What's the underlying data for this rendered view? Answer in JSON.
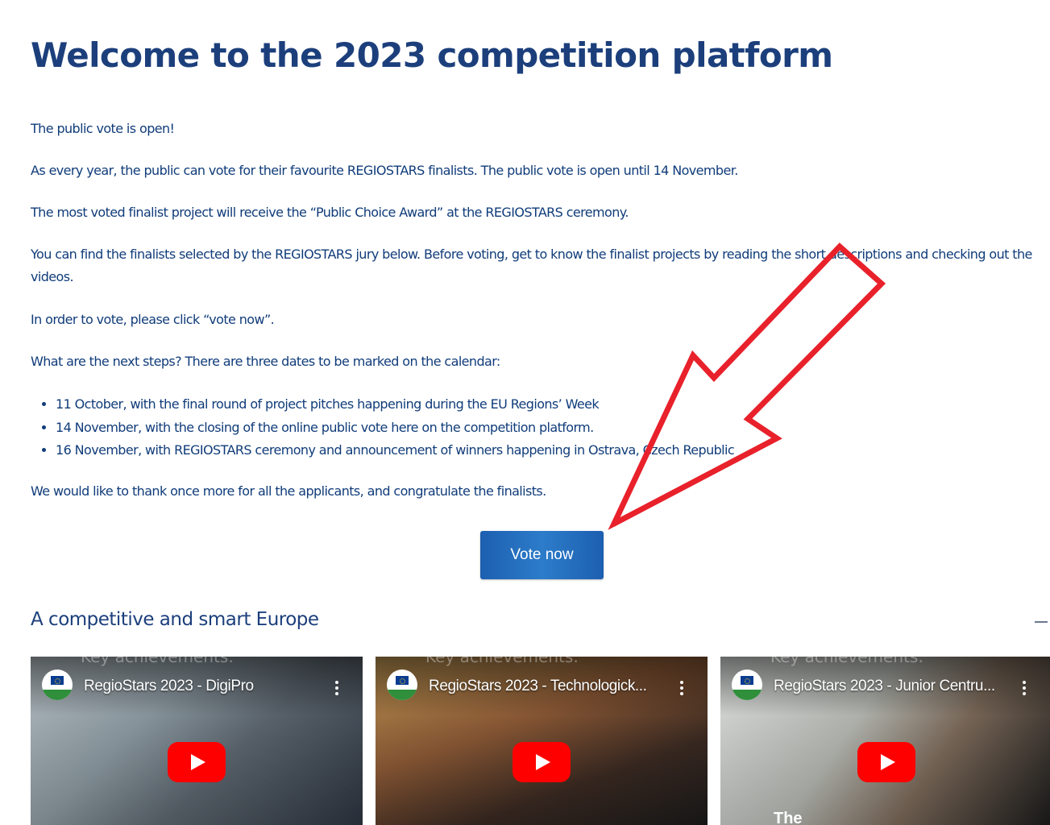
{
  "page": {
    "title": "Welcome to the 2023 competition platform",
    "paragraphs": [
      "The public vote is open!",
      "As every year, the public can vote for their favourite REGIOSTARS finalists. The public vote is open until 14 November.",
      "The most voted finalist project will receive the “Public Choice Award” at the REGIOSTARS ceremony.",
      "You can find the finalists selected by the REGIOSTARS jury below. Before voting, get to know the finalist projects by reading the short descriptions and checking out the videos.",
      "In order to vote, please click “vote now”.",
      "What are the next steps? There are three dates to be marked on the calendar:"
    ],
    "bullets": [
      "11 October, with the final round of project pitches happening during the EU Regions’ Week",
      "14 November, with the closing of the online public vote here on the competition platform.",
      "16 November, with REGIOSTARS ceremony and announcement of winners happening in Ostrava, Czech Republic"
    ],
    "closing": "We would like to thank once more for all the applicants, and congratulate the finalists.",
    "vote_button": "Vote now"
  },
  "section": {
    "title": "A competitive and smart Europe",
    "videos": [
      {
        "title": "RegioStars 2023 - DigiPro",
        "background_text": "Key achievements:",
        "caption": ""
      },
      {
        "title": "RegioStars 2023 - Technologick...",
        "background_text": "Key achievements:",
        "caption": ""
      },
      {
        "title": "RegioStars 2023 - Junior Centru...",
        "background_text": "Key achievements:",
        "caption": "The"
      }
    ]
  },
  "colors": {
    "heading": "#1c3f7c",
    "text": "#103c7a",
    "button": "#2a77c6",
    "annotation_arrow": "#e8212b",
    "play_button": "#ff0000"
  },
  "icons": [
    "channel-logo",
    "kebab-menu-icon",
    "youtube-play-icon",
    "collapse-icon",
    "annotation-arrow"
  ]
}
